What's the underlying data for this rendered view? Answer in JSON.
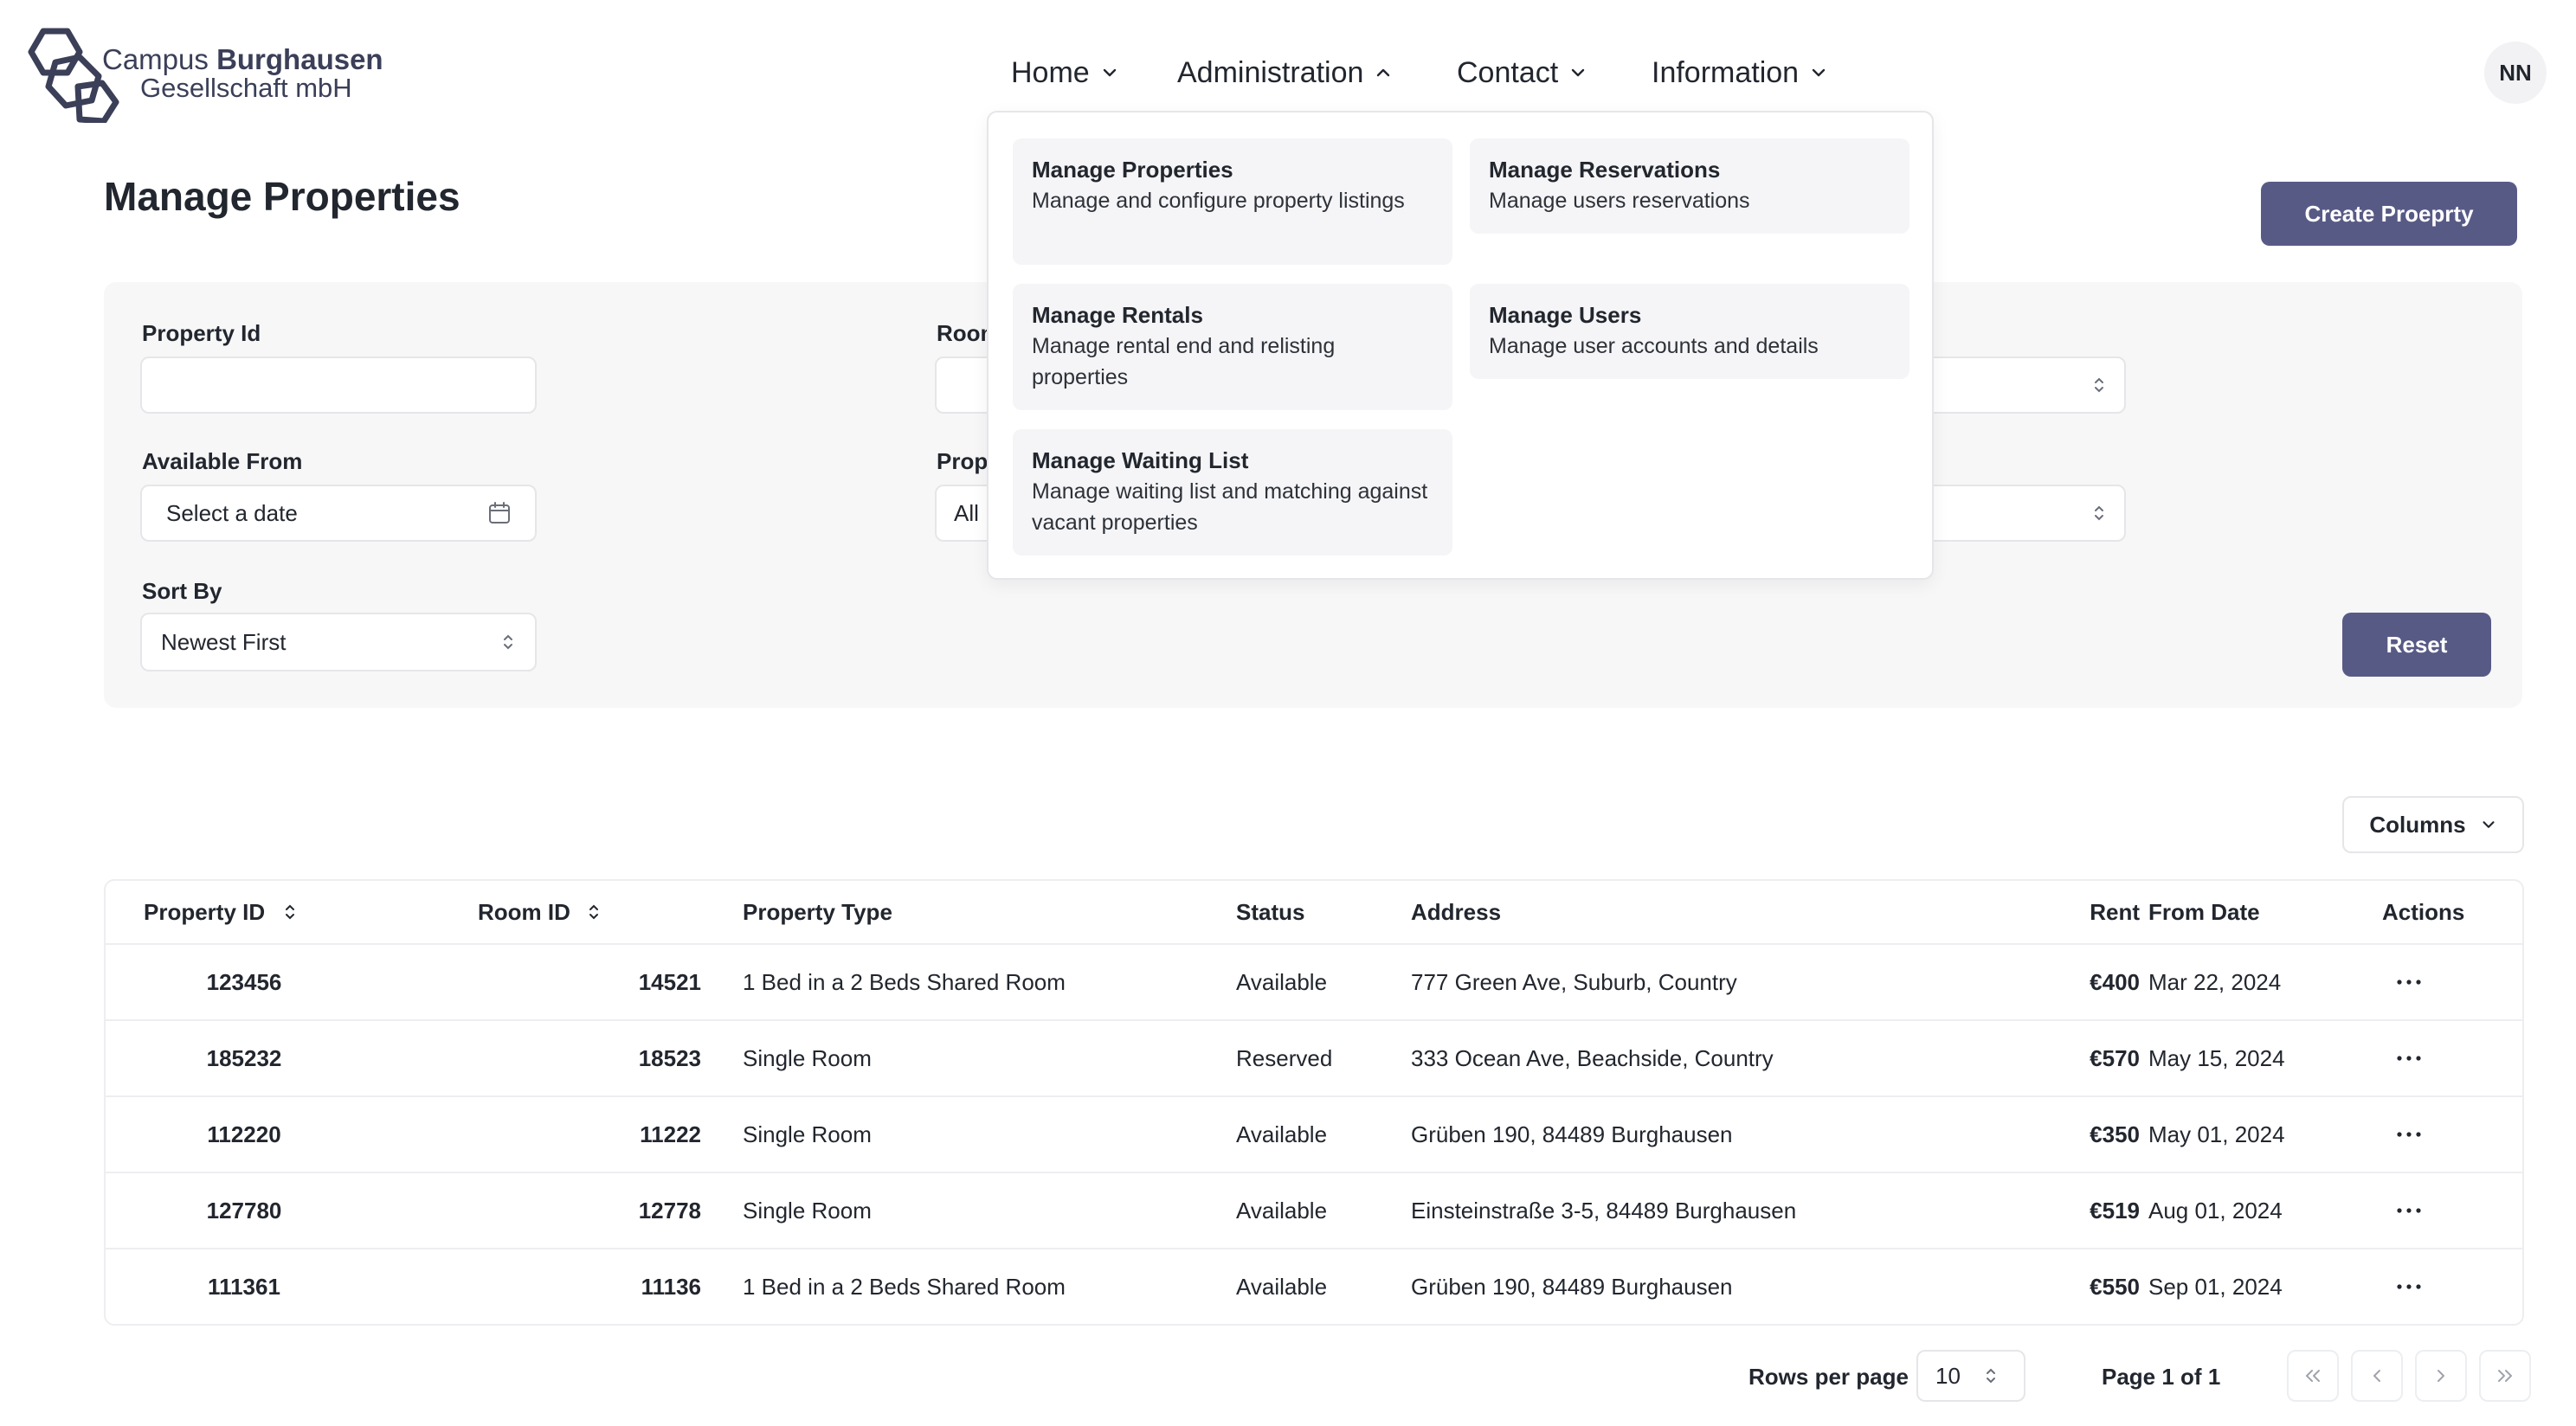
{
  "brand": {
    "line1_regular": "Campus",
    "line1_bold": "Burghausen",
    "line2": "Gesellschaft mbH"
  },
  "nav": {
    "home": "Home",
    "administration": "Administration",
    "contact": "Contact",
    "information": "Information"
  },
  "user": {
    "initials": "NN"
  },
  "page": {
    "title": "Manage Properties",
    "create_button": "Create Proeprty"
  },
  "filters": {
    "property_id_label": "Property Id",
    "property_id_value": "",
    "room_label": "Room",
    "available_from_label": "Available From",
    "available_from_placeholder": "Select a date",
    "property_label": "Prope",
    "property_value": "All",
    "sort_by_label": "Sort By",
    "sort_by_value": "Newest First",
    "reset_button": "Reset"
  },
  "admin_menu": {
    "items": [
      {
        "title": "Manage Properties",
        "description": "Manage and configure property listings"
      },
      {
        "title": "Manage Reservations",
        "description": "Manage users reservations"
      },
      {
        "title": "Manage Rentals",
        "description": "Manage rental end and relisting properties"
      },
      {
        "title": "Manage Users",
        "description": "Manage user accounts and details"
      },
      {
        "title": "Manage Waiting List",
        "description": "Manage waiting list and matching against vacant properties"
      }
    ]
  },
  "table": {
    "columns_button": "Columns",
    "headers": {
      "property_id": "Property ID",
      "room_id": "Room ID",
      "property_type": "Property Type",
      "status": "Status",
      "address": "Address",
      "rent": "Rent",
      "from_date": "From Date",
      "actions": "Actions"
    },
    "rows": [
      {
        "property_id": "123456",
        "room_id": "14521",
        "property_type": "1 Bed in a 2 Beds Shared Room",
        "status": "Available",
        "address": "777 Green Ave, Suburb, Country",
        "rent": "€400",
        "from_date": "Mar 22, 2024"
      },
      {
        "property_id": "185232",
        "room_id": "18523",
        "property_type": "Single Room",
        "status": "Reserved",
        "address": "333 Ocean Ave, Beachside, Country",
        "rent": "€570",
        "from_date": "May 15, 2024"
      },
      {
        "property_id": "112220",
        "room_id": "11222",
        "property_type": "Single Room",
        "status": "Available",
        "address": "Grüben 190, 84489 Burghausen",
        "rent": "€350",
        "from_date": "May 01, 2024"
      },
      {
        "property_id": "127780",
        "room_id": "12778",
        "property_type": "Single Room",
        "status": "Available",
        "address": "Einsteinstraße 3-5, 84489 Burghausen",
        "rent": "€519",
        "from_date": "Aug 01, 2024"
      },
      {
        "property_id": "111361",
        "room_id": "11136",
        "property_type": "1 Bed in a 2 Beds Shared Room",
        "status": "Available",
        "address": "Grüben 190, 84489 Burghausen",
        "rent": "€550",
        "from_date": "Sep 01, 2024"
      }
    ]
  },
  "pagination": {
    "rows_per_page_label": "Rows per page",
    "rows_per_page_value": "10",
    "page_info": "Page 1 of 1"
  },
  "colors": {
    "primary": "#585a86",
    "panel": "#f7f7f8",
    "border": "#e6e6ea"
  }
}
